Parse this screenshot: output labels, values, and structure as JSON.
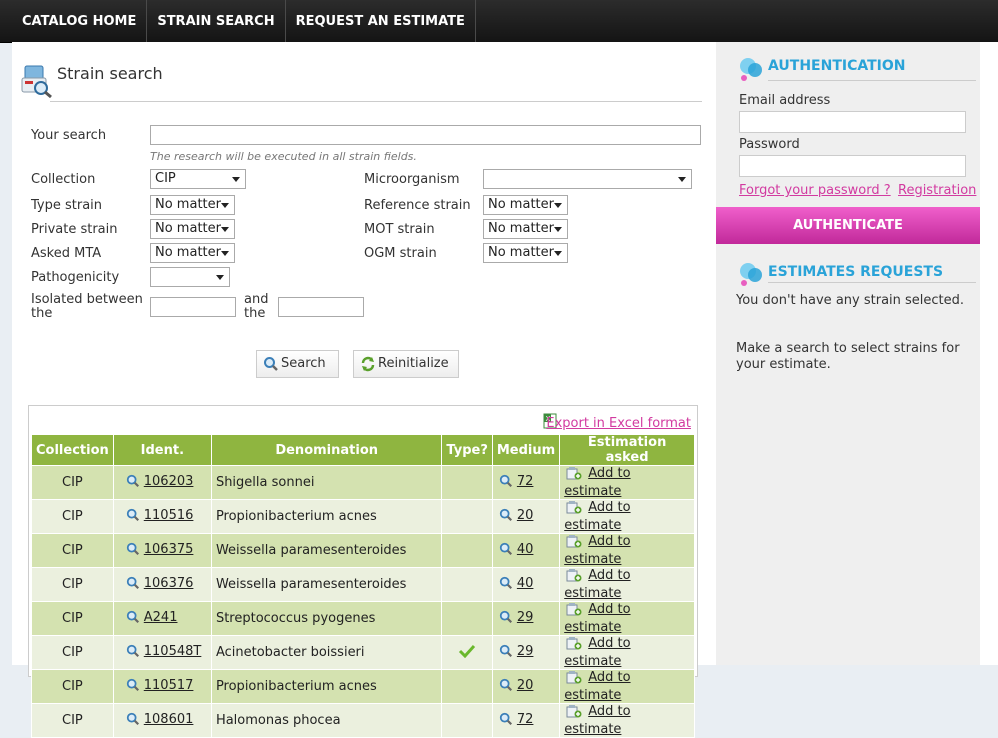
{
  "nav": {
    "items": [
      "CATALOG HOME",
      "STRAIN SEARCH",
      "REQUEST AN ESTIMATE"
    ]
  },
  "page": {
    "title": "Strain search"
  },
  "form": {
    "your_search_label": "Your search",
    "your_search_value": "",
    "hint": "The research will be executed in all strain fields.",
    "collection_label": "Collection",
    "collection_value": "CIP",
    "microorganism_label": "Microorganism",
    "microorganism_value": "",
    "type_strain_label": "Type strain",
    "type_strain_value": "No matter",
    "reference_strain_label": "Reference strain",
    "reference_strain_value": "No matter",
    "private_strain_label": "Private strain",
    "private_strain_value": "No matter",
    "mot_strain_label": "MOT strain",
    "mot_strain_value": "No matter",
    "asked_mta_label": "Asked MTA",
    "asked_mta_value": "No matter",
    "ogm_strain_label": "OGM strain",
    "ogm_strain_value": "No matter",
    "pathogenicity_label": "Pathogenicity",
    "pathogenicity_value": "",
    "isolated_between_label_1": "Isolated between",
    "isolated_between_label_2": "the",
    "and_label_1": "and",
    "and_label_2": "the",
    "search_button": "Search",
    "reinitialize_button": "Reinitialize"
  },
  "results": {
    "export_label": "Export in Excel format",
    "columns": [
      "Collection",
      "Ident.",
      "Denomination",
      "Type?",
      "Medium",
      "Estimation asked"
    ],
    "add_label": "Add to estimate",
    "rows": [
      {
        "collection": "CIP",
        "ident": "106203",
        "denomination": "Shigella sonnei",
        "type": false,
        "medium": "72"
      },
      {
        "collection": "CIP",
        "ident": "110516",
        "denomination": "Propionibacterium acnes",
        "type": false,
        "medium": "20"
      },
      {
        "collection": "CIP",
        "ident": "106375",
        "denomination": "Weissella paramesenteroides",
        "type": false,
        "medium": "40"
      },
      {
        "collection": "CIP",
        "ident": "106376",
        "denomination": "Weissella paramesenteroides",
        "type": false,
        "medium": "40"
      },
      {
        "collection": "CIP",
        "ident": "A241",
        "denomination": "Streptococcus pyogenes",
        "type": false,
        "medium": "29"
      },
      {
        "collection": "CIP",
        "ident": "110548T",
        "denomination": "Acinetobacter boissieri",
        "type": true,
        "medium": "29"
      },
      {
        "collection": "CIP",
        "ident": "110517",
        "denomination": "Propionibacterium acnes",
        "type": false,
        "medium": "20"
      },
      {
        "collection": "CIP",
        "ident": "108601",
        "denomination": "Halomonas phocea",
        "type": false,
        "medium": "72"
      }
    ]
  },
  "sidebar": {
    "auth_title": "AUTHENTICATION",
    "email_label": "Email address",
    "email_value": "",
    "password_label": "Password",
    "password_value": "",
    "forgot_link": "Forgot your password ?",
    "registration_link": "Registration",
    "auth_button": "AUTHENTICATE",
    "estimates_title": "ESTIMATES REQUESTS",
    "estimates_text_1": "You don't have any strain selected.",
    "estimates_text_2": "Make a search to select strains for your estimate."
  },
  "colors": {
    "accent_green": "#8fb540",
    "accent_pink": "#d23aa0",
    "accent_blue": "#2aa3d8"
  }
}
